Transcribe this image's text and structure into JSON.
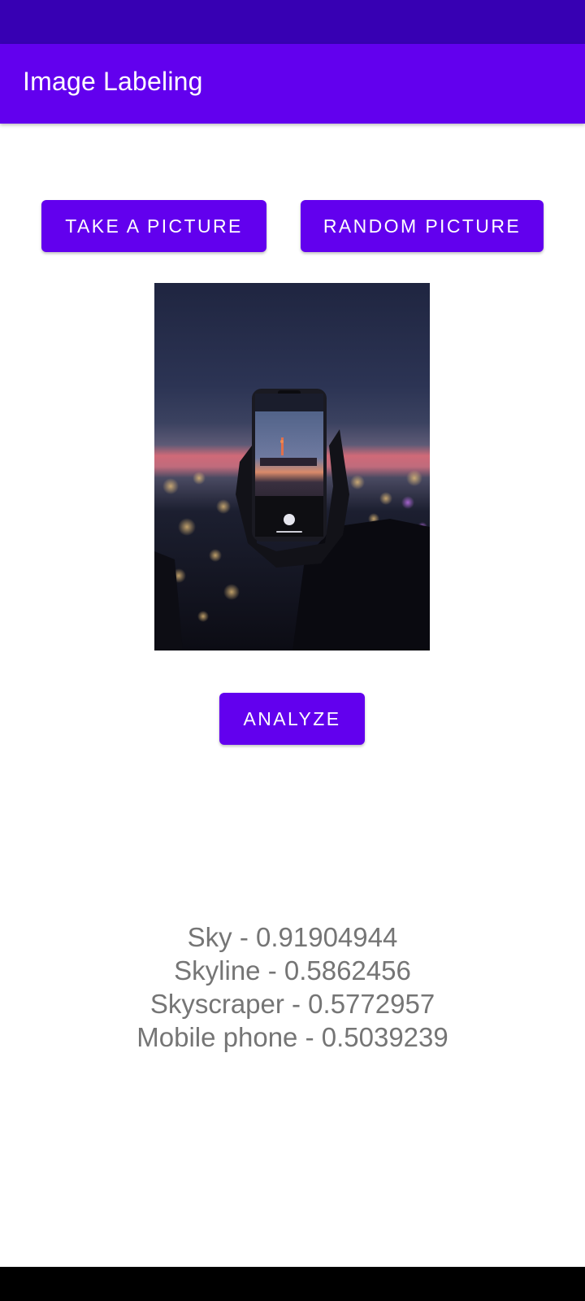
{
  "colors": {
    "status_bar": "#3700B3",
    "primary": "#6200EE",
    "result_text": "#757575",
    "nav_bar": "#000000"
  },
  "app_bar": {
    "title": "Image Labeling"
  },
  "buttons": {
    "take_picture": "TAKE A PICTURE",
    "random_picture": "RANDOM PICTURE",
    "analyze": "ANALYZE"
  },
  "image": {
    "subject": "hand holding smartphone photographing city skyline at dusk"
  },
  "results": [
    "Sky - 0.91904944",
    "Skyline - 0.5862456",
    "Skyscraper - 0.5772957",
    "Mobile phone - 0.5039239"
  ]
}
